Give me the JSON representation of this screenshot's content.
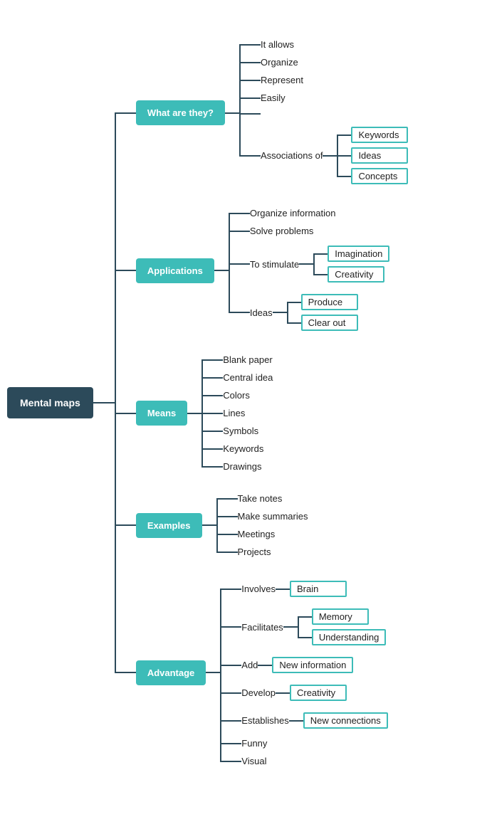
{
  "root": {
    "label": "Mental maps"
  },
  "branches": [
    {
      "id": "what",
      "label": "What are they?",
      "sub": [
        {
          "text": "It allows",
          "children": []
        },
        {
          "text": "Organize",
          "children": []
        },
        {
          "text": "Represent",
          "children": []
        },
        {
          "text": "Easily",
          "children": []
        },
        {
          "text": "",
          "spacer": true
        },
        {
          "text": "Associations of",
          "children": [
            {
              "text": "Keywords",
              "boxed": true
            },
            {
              "text": "Ideas",
              "boxed": true
            },
            {
              "text": "Concepts",
              "boxed": true
            }
          ]
        }
      ]
    },
    {
      "id": "applications",
      "label": "Applications",
      "sub": [
        {
          "text": "Organize information",
          "children": []
        },
        {
          "text": "Solve problems",
          "children": []
        },
        {
          "text": "To stimulate",
          "children": [
            {
              "text": "Imagination",
              "boxed": true
            },
            {
              "text": "Creativity",
              "boxed": true
            }
          ]
        },
        {
          "text": "Ideas",
          "children": [
            {
              "text": "Produce",
              "boxed": true
            },
            {
              "text": "Clear out",
              "boxed": true
            }
          ]
        }
      ]
    },
    {
      "id": "means",
      "label": "Means",
      "sub": [
        {
          "text": "Blank paper",
          "children": []
        },
        {
          "text": "Central idea",
          "children": []
        },
        {
          "text": "Colors",
          "children": []
        },
        {
          "text": "Lines",
          "children": []
        },
        {
          "text": "Symbols",
          "children": []
        },
        {
          "text": "Keywords",
          "children": []
        },
        {
          "text": "Drawings",
          "children": []
        }
      ]
    },
    {
      "id": "examples",
      "label": "Examples",
      "sub": [
        {
          "text": "Take notes",
          "children": []
        },
        {
          "text": "Make summaries",
          "children": []
        },
        {
          "text": "Meetings",
          "children": []
        },
        {
          "text": "Projects",
          "children": []
        }
      ]
    },
    {
      "id": "advantage",
      "label": "Advantage",
      "sub": [
        {
          "text": "Involves",
          "children": [
            {
              "text": "Brain",
              "boxed": true
            }
          ]
        },
        {
          "text": "Facilitates",
          "children": [
            {
              "text": "Memory",
              "boxed": true
            },
            {
              "text": "Understanding",
              "boxed": true
            }
          ]
        },
        {
          "text": "Add",
          "children": [
            {
              "text": "New information",
              "boxed": true
            }
          ]
        },
        {
          "text": "Develop",
          "children": [
            {
              "text": "Creativity",
              "boxed": true
            }
          ]
        },
        {
          "text": "Establishes",
          "children": [
            {
              "text": "New connections",
              "boxed": true
            }
          ]
        },
        {
          "text": "Funny",
          "children": []
        },
        {
          "text": "Visual",
          "children": []
        }
      ]
    }
  ]
}
